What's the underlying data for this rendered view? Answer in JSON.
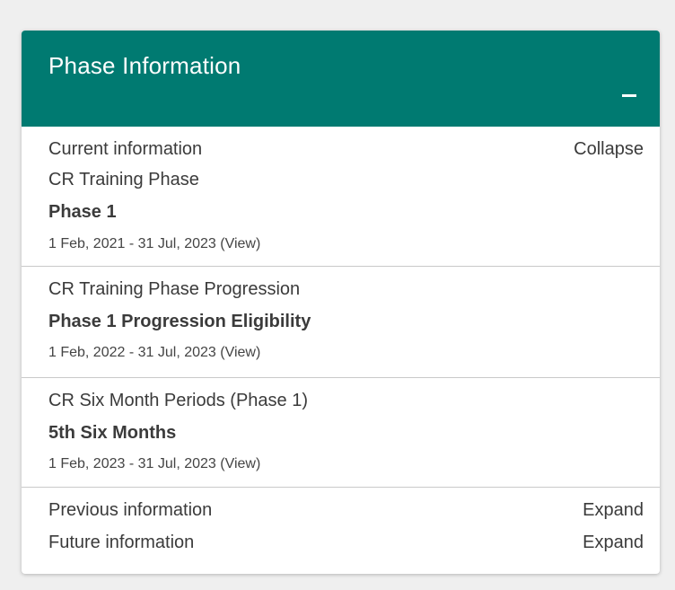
{
  "card": {
    "title": "Phase Information",
    "collapse_icon": "minus-icon"
  },
  "current": {
    "heading": "Current information",
    "toggle_label": "Collapse"
  },
  "phases": [
    {
      "category": "CR Training Phase",
      "name": "Phase 1",
      "dates": "1 Feb, 2021 - 31 Jul, 2023",
      "view_label": "(View)"
    },
    {
      "category": "CR Training Phase Progression",
      "name": "Phase 1 Progression Eligibility",
      "dates": "1 Feb, 2022 - 31 Jul, 2023",
      "view_label": "(View)"
    },
    {
      "category": "CR Six Month Periods (Phase 1)",
      "name": "5th Six Months",
      "dates": "1 Feb, 2023 - 31 Jul, 2023",
      "view_label": "(View)"
    }
  ],
  "previous": {
    "label": "Previous information",
    "toggle_label": "Expand"
  },
  "future": {
    "label": "Future information",
    "toggle_label": "Expand"
  },
  "colors": {
    "header_bg": "#007a71",
    "page_bg": "#efefef"
  }
}
